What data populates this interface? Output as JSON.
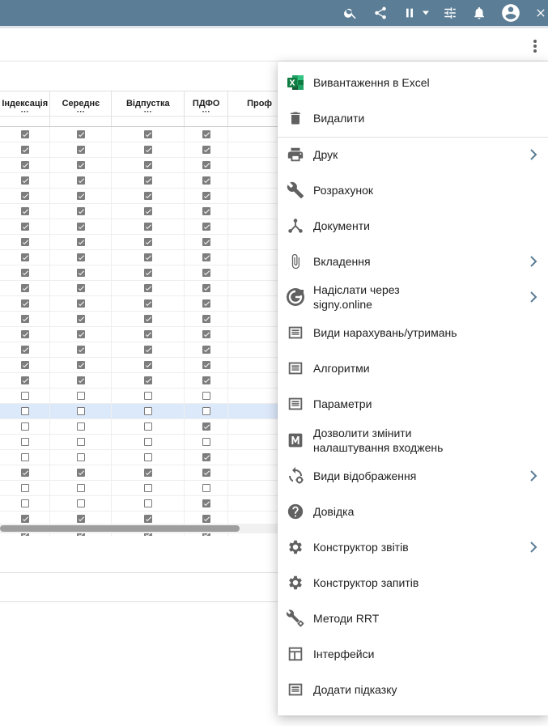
{
  "topbar": {
    "icons": [
      "search-icon",
      "share-icon",
      "pause-icon",
      "chevron-down-icon",
      "tune-icon",
      "bell-icon",
      "account-icon",
      "close-icon"
    ],
    "color": "#5b7d95"
  },
  "grid": {
    "columns": [
      {
        "label": "Індексація",
        "dots": "···"
      },
      {
        "label": "Середнє",
        "dots": "···"
      },
      {
        "label": "Відпустка",
        "dots": "···"
      },
      {
        "label": "ПДФО",
        "dots": "···"
      },
      {
        "label": "Проф",
        "dots": ""
      }
    ],
    "rows": [
      [
        1,
        1,
        1,
        1
      ],
      [
        1,
        1,
        1,
        1
      ],
      [
        1,
        1,
        1,
        1
      ],
      [
        1,
        1,
        1,
        1
      ],
      [
        1,
        1,
        1,
        1
      ],
      [
        1,
        1,
        1,
        1
      ],
      [
        1,
        1,
        1,
        1
      ],
      [
        1,
        1,
        1,
        1
      ],
      [
        1,
        1,
        1,
        1
      ],
      [
        1,
        1,
        1,
        1
      ],
      [
        1,
        1,
        1,
        1
      ],
      [
        1,
        1,
        1,
        1
      ],
      [
        1,
        1,
        1,
        1
      ],
      [
        1,
        1,
        1,
        1
      ],
      [
        1,
        1,
        1,
        1
      ],
      [
        1,
        1,
        1,
        1
      ],
      [
        1,
        1,
        1,
        1
      ],
      [
        0,
        0,
        0,
        0
      ],
      [
        0,
        0,
        0,
        0
      ],
      [
        0,
        0,
        0,
        1
      ],
      [
        0,
        0,
        0,
        0
      ],
      [
        0,
        0,
        0,
        1
      ],
      [
        1,
        1,
        1,
        1
      ],
      [
        0,
        0,
        0,
        0
      ],
      [
        0,
        0,
        0,
        1
      ],
      [
        1,
        1,
        1,
        1
      ],
      [
        1,
        1,
        1,
        1
      ],
      [
        1,
        1,
        1,
        1
      ],
      [
        1,
        1,
        1,
        1
      ]
    ],
    "selected_row": 18
  },
  "menu": {
    "items": [
      {
        "label": "Вивантаження в Excel",
        "icon": "excel-icon",
        "submenu": false
      },
      {
        "label": "Видалити",
        "icon": "trash-icon",
        "submenu": false
      },
      {
        "label": "Друк",
        "icon": "printer-icon",
        "submenu": true
      },
      {
        "label": "Розрахунок",
        "icon": "wrench-icon",
        "submenu": false
      },
      {
        "label": "Документи",
        "icon": "hub-icon",
        "submenu": false
      },
      {
        "label": "Вкладення",
        "icon": "paperclip-icon",
        "submenu": true
      },
      {
        "label": "Надіслати через\nsigny.online",
        "icon": "signy-icon",
        "submenu": true
      },
      {
        "label": "Види нарахувань/утримань",
        "icon": "list-icon",
        "submenu": false
      },
      {
        "label": "Алгоритми",
        "icon": "list-icon",
        "submenu": false
      },
      {
        "label": "Параметри",
        "icon": "list-icon",
        "submenu": false
      },
      {
        "label": "Дозволити змінити\nналаштування входжень",
        "icon": "m-icon",
        "submenu": false
      },
      {
        "label": "Види відображення",
        "icon": "refresh-gear-icon",
        "submenu": true
      },
      {
        "label": "Довідка",
        "icon": "help-icon",
        "submenu": false
      },
      {
        "label": "Конструктор звітів",
        "icon": "gear-icon",
        "submenu": true
      },
      {
        "label": "Конструктор запитів",
        "icon": "gear-icon",
        "submenu": false
      },
      {
        "label": "Методи RRT",
        "icon": "wrench-gear-icon",
        "submenu": false
      },
      {
        "label": "Інтерфейси",
        "icon": "layout-icon",
        "submenu": false
      },
      {
        "label": "Додати підказку",
        "icon": "list-icon",
        "submenu": false
      }
    ]
  }
}
